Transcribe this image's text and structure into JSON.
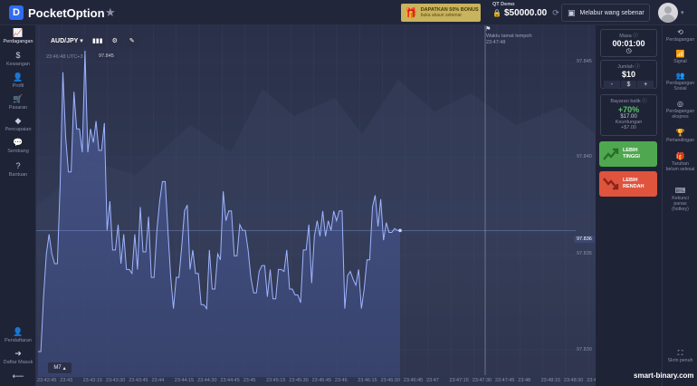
{
  "header": {
    "logo_mark": "D",
    "logo_text": "PocketOption",
    "promo_title": "DAPATKAN 50% BONUS",
    "promo_subtitle": "buka akaun sebenar",
    "account_label": "QT Demo",
    "balance": "$50000.00",
    "balance_caret": "⌄",
    "deposit_label": "Melabur wang sebenar"
  },
  "left_nav": [
    {
      "icon": "chart-line-icon",
      "glyph": "📈",
      "label": "Perdagangan",
      "active": true
    },
    {
      "icon": "dollar-icon",
      "glyph": "$",
      "label": "Kewangan",
      "active": false
    },
    {
      "icon": "profile-icon",
      "glyph": "👤",
      "label": "Profil",
      "active": false
    },
    {
      "icon": "cart-icon",
      "glyph": "🛒",
      "label": "Pasaran",
      "active": false
    },
    {
      "icon": "diamond-icon",
      "glyph": "◆",
      "label": "Pencapaian",
      "active": false
    },
    {
      "icon": "chat-icon",
      "glyph": "💬",
      "label": "Sembang",
      "active": false
    },
    {
      "icon": "help-icon",
      "glyph": "?",
      "label": "Bantuan",
      "active": false
    }
  ],
  "left_nav_bottom": [
    {
      "icon": "add-user-icon",
      "glyph": "👤",
      "label": "Pendaftaran"
    },
    {
      "icon": "login-icon",
      "glyph": "➜",
      "label": "Daftar Masuk"
    },
    {
      "icon": "collapse-icon",
      "glyph": "⟵",
      "label": ""
    }
  ],
  "toolbar": {
    "pair": "AUD/JPY",
    "timestamp": "23:46:48 UTC+3",
    "price_badge": "97.845"
  },
  "expiration_label": [
    "Waktu tamat tempoh",
    "23:47:48"
  ],
  "trade_panel": {
    "time_caption": "Masa",
    "time_value": "00:01:00",
    "amount_caption": "Jumlah",
    "amount_value": "$10",
    "minus": "-",
    "dollar": "$",
    "plus": "+",
    "payout_caption": "Bayaran balik",
    "payout_percent": "+70%",
    "payout_amount": "$17.00",
    "profit_caption": "Keuntungan",
    "profit_value": "+$7.00",
    "higher_label": [
      "LEBIH",
      "TINGGI"
    ],
    "lower_label": [
      "LEBIH",
      "RENDAH"
    ]
  },
  "right_nav": [
    {
      "icon": "history-icon",
      "glyph": "⟲",
      "label": [
        "Perdagangan"
      ]
    },
    {
      "icon": "signal-icon",
      "glyph": "📶",
      "label": [
        "Signal"
      ]
    },
    {
      "icon": "social-icon",
      "glyph": "👥",
      "label": [
        "Perdagangan",
        "Sosial"
      ]
    },
    {
      "icon": "express-icon",
      "glyph": "◎",
      "label": [
        "Perdagangan",
        "ekspres"
      ]
    },
    {
      "icon": "trophy-icon",
      "glyph": "🏆",
      "label": [
        "Pertandingan"
      ]
    },
    {
      "icon": "bonus-icon",
      "glyph": "🎁",
      "label": [
        "Taruhan",
        "belum selesai"
      ]
    },
    {
      "icon": "hotkey-icon",
      "glyph": "⌨",
      "label": [
        "Kekunci",
        "panas",
        "(hotkey)"
      ]
    },
    {
      "icon": "fullscreen-icon",
      "glyph": "⛶",
      "label": [
        "Skrin penuh"
      ]
    }
  ],
  "price_axis": [
    "97.845",
    "97.840",
    "97.835",
    "97.830"
  ],
  "current_price": "97.836",
  "timeframe": "M7",
  "time_axis": [
    "23:42:45",
    "23:43",
    "23:43:15",
    "23:43:30",
    "23:43:45",
    "23:44",
    "23:44:15",
    "23:44:30",
    "23:44:45",
    "23:45",
    "23:45:15",
    "23:45:30",
    "23:45:45",
    "23:46",
    "23:46:15",
    "23:46:30",
    "23:46:45",
    "23:47",
    "23:47:15",
    "23:47:30",
    "23:47:45",
    "23:48",
    "23:48:15",
    "23:48:30",
    "23:48:45"
  ],
  "watermark": "smart-binary.com",
  "colors": {
    "higher": "#4fa84f",
    "lower": "#e0533d",
    "line": "#9fb4ff",
    "payout": "#5cc46b"
  },
  "chart_data": {
    "type": "area",
    "ylim": [
      97.8285,
      97.8465
    ],
    "series": [
      {
        "values": [
          97.8298,
          97.8298,
          97.8326,
          97.8348,
          97.8358,
          97.8348,
          97.8343,
          97.8343,
          97.8383,
          97.8441,
          97.8408,
          97.839,
          97.839,
          97.8431,
          97.8412,
          97.8412,
          97.84,
          97.8452,
          97.84,
          97.8412,
          97.8405,
          97.8416,
          97.8401,
          97.8401,
          97.8415,
          97.836,
          97.8375,
          97.835,
          97.835,
          97.8363,
          97.8343,
          97.8358,
          97.834,
          97.834,
          97.8338,
          97.8358,
          97.834,
          97.8372,
          97.8349,
          97.8349,
          97.8367,
          97.8336,
          97.8336,
          97.836,
          97.8375,
          97.8385,
          97.8385,
          97.836,
          97.8336,
          97.832,
          97.8336,
          97.8336,
          97.8352,
          97.837,
          97.8373,
          97.834,
          97.835,
          97.8338,
          97.8338,
          97.8322,
          97.8322,
          97.832,
          97.835,
          97.833,
          97.833,
          97.8348,
          97.8345,
          97.838,
          97.8365,
          97.837,
          97.837,
          97.8347,
          97.8347,
          97.8363,
          97.836,
          97.836,
          97.835,
          97.8336,
          97.8328,
          97.8328,
          97.8339,
          97.8342,
          97.8342,
          97.8326,
          97.834,
          97.8325,
          97.8325,
          97.834,
          97.834,
          97.8339,
          97.835,
          97.833,
          97.833,
          97.8327,
          97.8327,
          97.8323,
          97.835,
          97.835,
          97.8363,
          97.8333,
          97.8357,
          97.8365,
          97.8357,
          97.837,
          97.8357,
          97.8365,
          97.836,
          97.837,
          97.8365,
          97.837,
          97.837,
          97.832,
          97.8337,
          97.8339,
          97.8335,
          97.8332,
          97.834,
          97.832,
          97.833,
          97.8345,
          97.8345,
          97.8372,
          97.8378,
          97.8362,
          97.8376,
          97.8355,
          97.8364,
          97.8359,
          97.8359,
          97.8361,
          97.836,
          97.836
        ]
      }
    ]
  }
}
